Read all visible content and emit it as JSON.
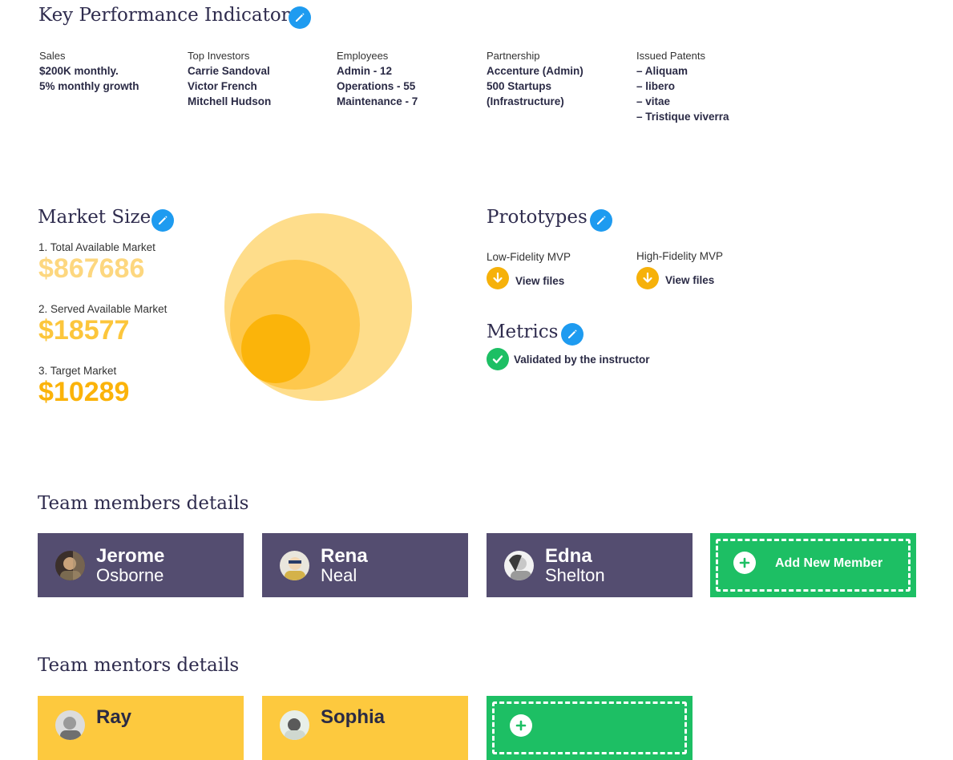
{
  "kpi": {
    "title": "Key Performance Indicators",
    "columns": [
      {
        "label": "Sales",
        "lines": [
          "$200K monthly.",
          "5% monthly growth"
        ]
      },
      {
        "label": "Top Investors",
        "lines": [
          "Carrie Sandoval",
          "Victor French",
          "Mitchell Hudson"
        ]
      },
      {
        "label": "Employees",
        "lines": [
          "Admin - 12",
          "Operations - 55",
          "Maintenance - 7"
        ]
      },
      {
        "label": "Partnership",
        "lines": [
          "Accenture (Admin)",
          "500 Startups",
          "(Infrastructure)"
        ]
      },
      {
        "label": "Issued Patents",
        "lines": [
          "– Aliquam",
          "– libero",
          "– vitae",
          "– Tristique viverra"
        ]
      }
    ]
  },
  "market": {
    "title": "Market Size",
    "items": [
      {
        "label": "1. Total Available Market",
        "value": "$867686",
        "color": "#fdd77f"
      },
      {
        "label": "2. Served Available Market",
        "value": "$18577",
        "color": "#fcc63c"
      },
      {
        "label": "3. Target Market",
        "value": "$10289",
        "color": "#fbb30a"
      }
    ],
    "circle_colors": [
      "#fedd8b",
      "#fec84d",
      "#fbb40a"
    ]
  },
  "prototypes": {
    "title": "Prototypes",
    "items": [
      {
        "label": "Low-Fidelity MVP",
        "link": "View files"
      },
      {
        "label": "High-Fidelity MVP",
        "link": "View files"
      }
    ]
  },
  "metrics": {
    "title": "Metrics",
    "status": "Validated by the instructor"
  },
  "team": {
    "title": "Team members details",
    "members": [
      {
        "first": "Jerome",
        "last": "Osborne"
      },
      {
        "first": "Rena",
        "last": "Neal"
      },
      {
        "first": "Edna",
        "last": "Shelton"
      }
    ],
    "add_label": "Add New Member"
  },
  "mentors": {
    "title": "Team mentors details",
    "members": [
      {
        "first": "Ray"
      },
      {
        "first": "Sophia"
      }
    ]
  },
  "colors": {
    "accent_blue": "#1e9bf0",
    "member_card": "#544d70",
    "mentor_card": "#fdc93e",
    "add_green": "#1dbf64"
  }
}
